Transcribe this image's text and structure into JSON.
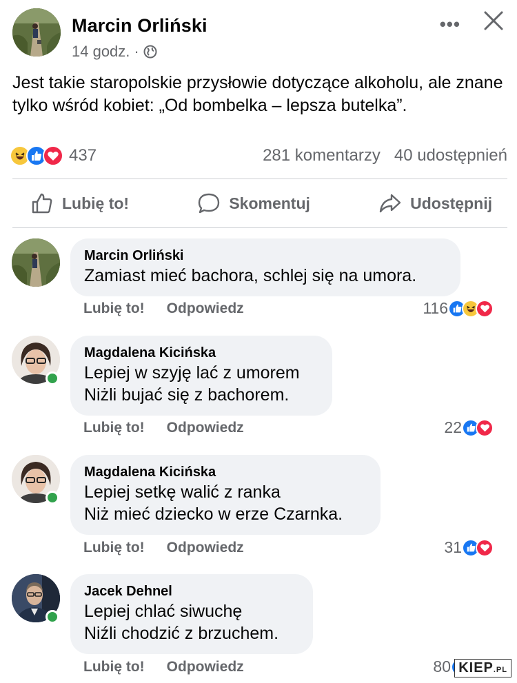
{
  "post": {
    "author": "Marcin Orliński",
    "time": "14 godz.",
    "separator": "·",
    "text": "Jest takie staropolskie przysłowie dotyczące alkoholu, ale znane tylko wśród kobiet: „Od bombelka – lepsza butelka”.",
    "more_label": "•••",
    "reactions_count": "437",
    "comments_count": "281 komentarzy",
    "shares_count": "40 udostępnień",
    "reaction_icons": [
      "haha",
      "like",
      "love"
    ]
  },
  "actions": {
    "like": "Lubię to!",
    "comment": "Skomentuj",
    "share": "Udostępnij"
  },
  "comments": [
    {
      "author": "Marcin Orliński",
      "lines": [
        "Zamiast mieć bachora, schlej się na umora."
      ],
      "like_label": "Lubię to!",
      "reply_label": "Odpowiedz",
      "reactions_count": "116",
      "reaction_icons": [
        "like",
        "haha",
        "love"
      ],
      "online": false
    },
    {
      "author": "Magdalena Kicińska",
      "lines": [
        "Lepiej w szyję lać z umorem",
        "Niżli bujać się z bachorem."
      ],
      "like_label": "Lubię to!",
      "reply_label": "Odpowiedz",
      "reactions_count": "22",
      "reaction_icons": [
        "like",
        "love"
      ],
      "online": true
    },
    {
      "author": "Magdalena Kicińska",
      "lines": [
        "Lepiej setkę walić z ranka",
        "Niż mieć dziecko w erze Czarnka."
      ],
      "like_label": "Lubię to!",
      "reply_label": "Odpowiedz",
      "reactions_count": "31",
      "reaction_icons": [
        "like",
        "love"
      ],
      "online": true
    },
    {
      "author": "Jacek Dehnel",
      "lines": [
        "Lepiej chlać siwuchę",
        "Niźli chodzić z brzuchem."
      ],
      "like_label": "Lubię to!",
      "reply_label": "Odpowiedz",
      "reactions_count": "80",
      "reaction_icons": [
        "like",
        "haha"
      ],
      "online": true
    }
  ],
  "watermark": {
    "main": "KIEP",
    "suffix": ".PL"
  },
  "colors": {
    "like": "#1877f2",
    "love": "#f02849",
    "haha": "#f7c73c",
    "online": "#31a24c",
    "bubble": "#f0f2f5",
    "secondary_text": "#65676b"
  }
}
